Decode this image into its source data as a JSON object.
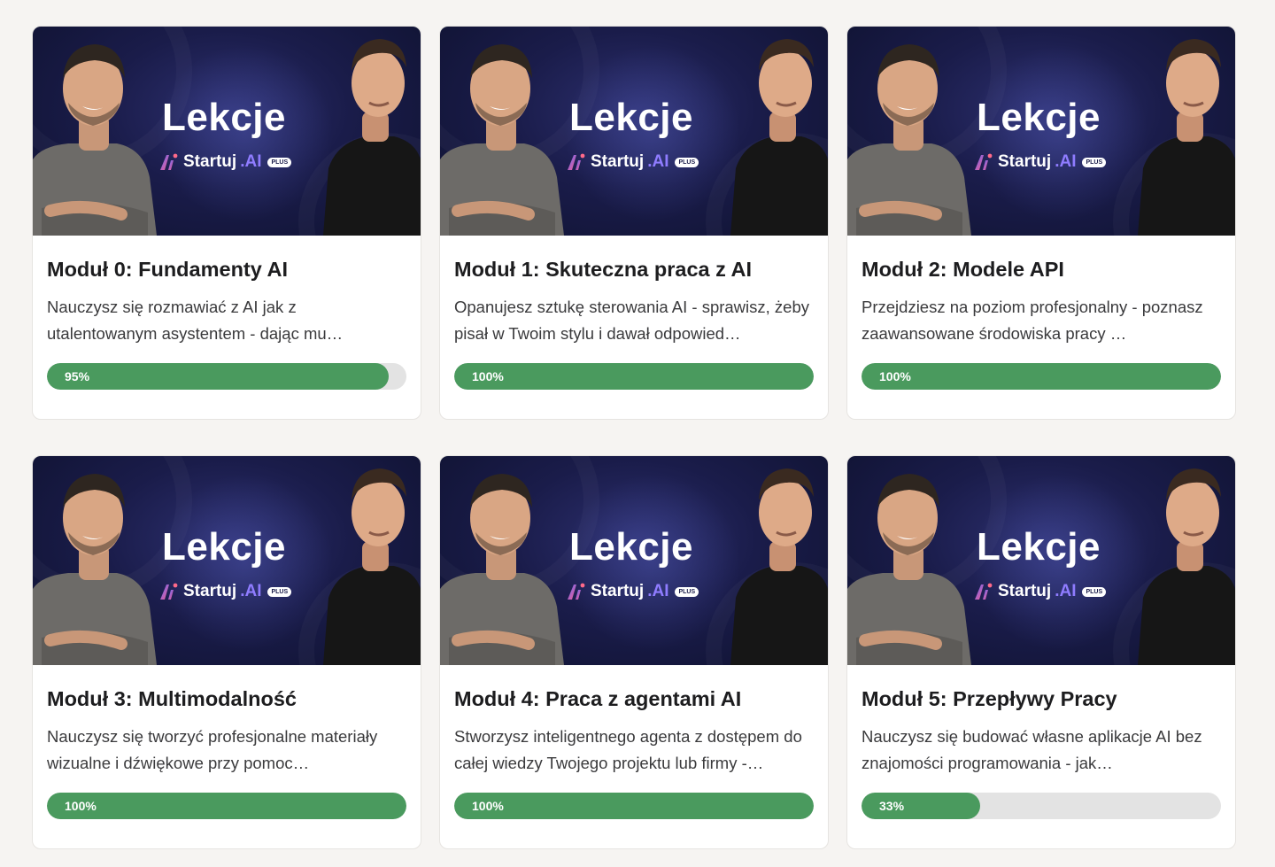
{
  "colors": {
    "page_bg": "#f6f4f2",
    "progress_fill": "#4a9a5e",
    "progress_track": "#e3e3e3",
    "thumbnail_bg": "#1a1c4a",
    "brand_accent": "#8f7cff"
  },
  "thumbnail": {
    "heading": "Lekcje",
    "brand_name": "Startuj",
    "brand_suffix": ".AI",
    "brand_badge": "PLUS"
  },
  "modules": [
    {
      "title": "Moduł 0: Fundamenty AI",
      "description": "Nauczysz się rozmawiać z AI jak z utalentowanym asystentem - dając mu…",
      "progress": 95,
      "progress_label": "95%"
    },
    {
      "title": "Moduł 1: Skuteczna praca z AI",
      "description": "Opanujesz sztukę sterowania AI - sprawisz, żeby pisał w Twoim stylu i dawał odpowied…",
      "progress": 100,
      "progress_label": "100%"
    },
    {
      "title": "Moduł 2: Modele API",
      "description": "Przejdziesz na poziom profesjonalny - poznasz zaawansowane środowiska pracy …",
      "progress": 100,
      "progress_label": "100%"
    },
    {
      "title": "Moduł 3: Multimodalność",
      "description": "Nauczysz się tworzyć profesjonalne materiały wizualne i dźwiękowe przy pomoc…",
      "progress": 100,
      "progress_label": "100%"
    },
    {
      "title": "Moduł 4: Praca z agentami AI",
      "description": "Stworzysz inteligentnego agenta z dostępem do całej wiedzy Twojego projektu lub firmy -…",
      "progress": 100,
      "progress_label": "100%"
    },
    {
      "title": "Moduł 5: Przepływy Pracy",
      "description": "Nauczysz się budować własne aplikacje AI bez znajomości programowania - jak…",
      "progress": 33,
      "progress_label": "33%"
    }
  ]
}
